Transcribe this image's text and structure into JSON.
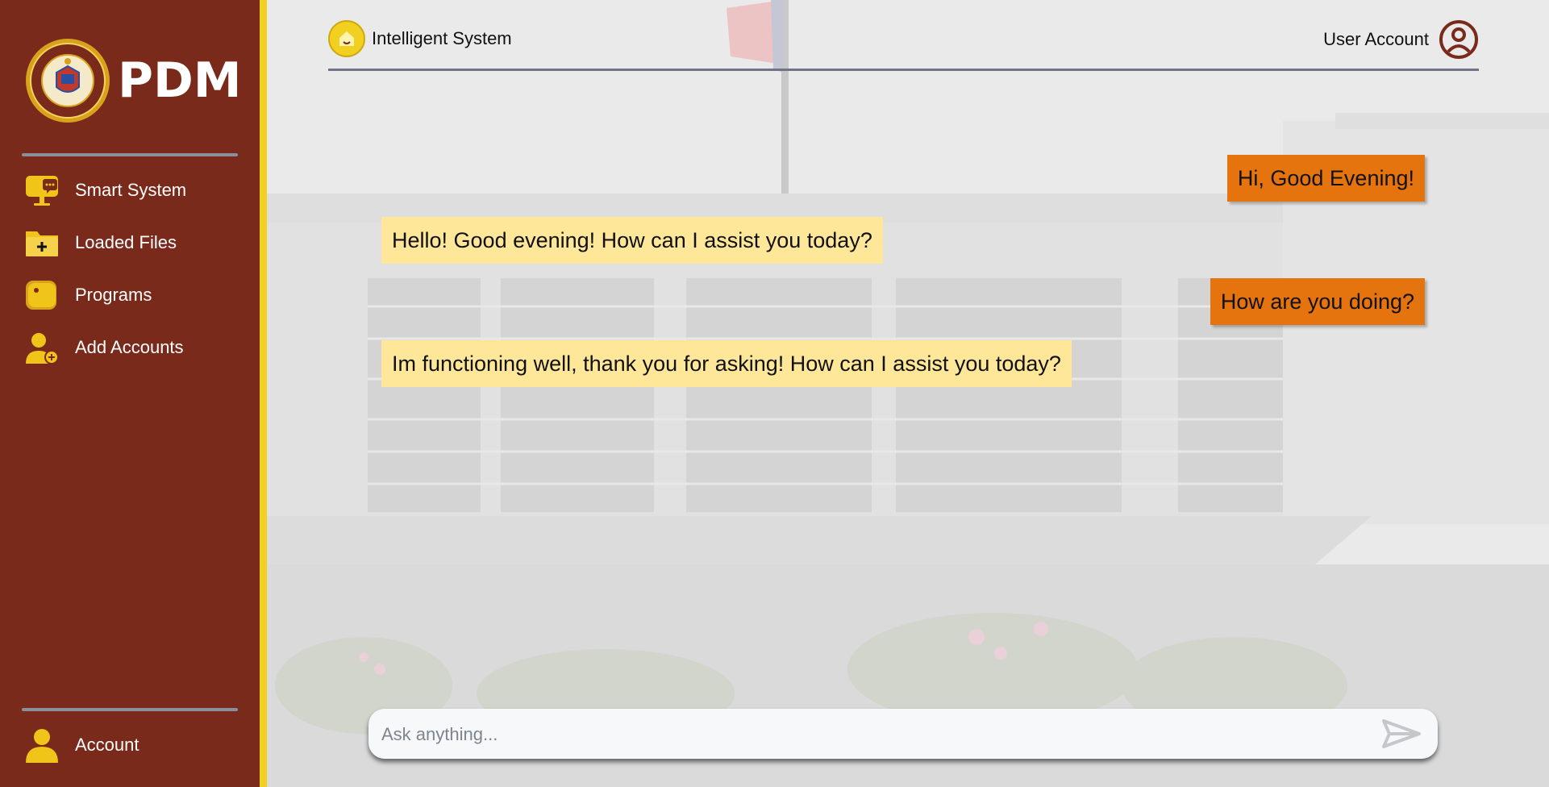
{
  "sidebar": {
    "brand": "PDM",
    "items": [
      {
        "label": "Smart System",
        "icon": "chat-monitor-icon"
      },
      {
        "label": "Loaded Files",
        "icon": "folder-plus-icon"
      },
      {
        "label": "Programs",
        "icon": "programs-icon"
      },
      {
        "label": "Add Accounts",
        "icon": "add-user-icon"
      }
    ],
    "account": {
      "label": "Account",
      "icon": "user-icon"
    }
  },
  "header": {
    "system_label": "Intelligent System",
    "account_label": "User Account"
  },
  "chat": {
    "messages": [
      {
        "role": "user",
        "text": "Hi, Good Evening!"
      },
      {
        "role": "bot",
        "text": "Hello! Good evening! How can I assist you today?"
      },
      {
        "role": "user",
        "text": "How are you doing?"
      },
      {
        "role": "bot",
        "text": "Im functioning well, thank you for asking! How can I assist you today?"
      }
    ]
  },
  "input": {
    "placeholder": "Ask anything...",
    "value": ""
  },
  "colors": {
    "sidebar_bg": "#7a2a1a",
    "accent_yellow": "#f2d020",
    "user_bubble": "#e5740e",
    "bot_bubble": "#ffe79a"
  }
}
